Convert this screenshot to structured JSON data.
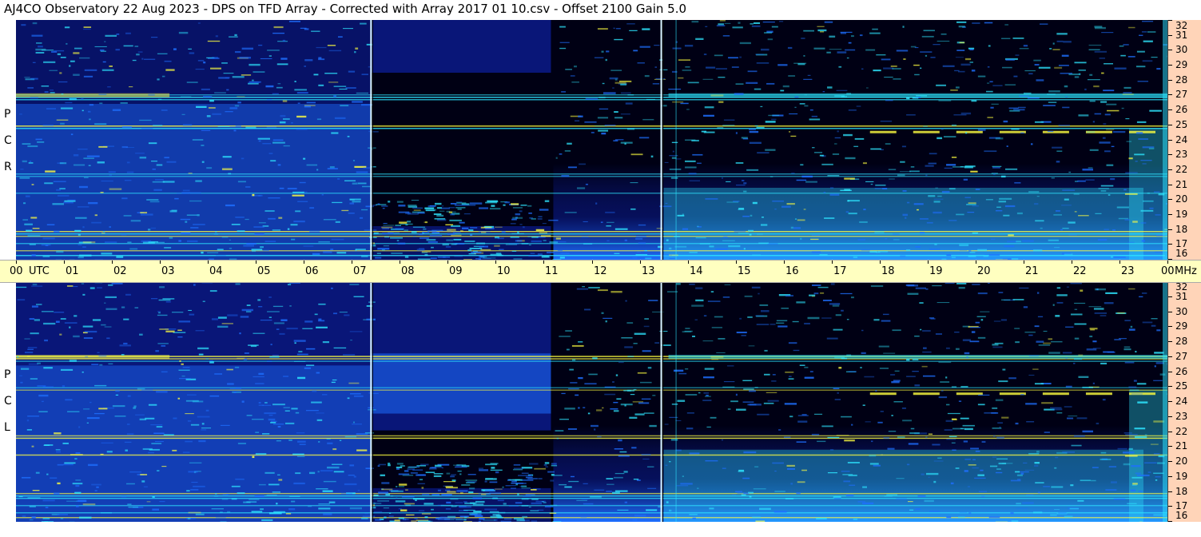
{
  "header": {
    "title": "AJ4CO Observatory  22 Aug 2023  -  DPS on TFD Array  -  Corrected with Array 2017 01 10.csv  -  Offset 2100  Gain 5.0"
  },
  "chart_data": {
    "type": "heatmap",
    "panels": [
      {
        "name": "RCP",
        "letters": [
          "P",
          "C",
          "R"
        ]
      },
      {
        "name": "LCP",
        "letters": [
          "P",
          "C",
          "L"
        ]
      }
    ],
    "time_axis": {
      "unit_label": "UTC",
      "tick_labels": [
        "00",
        "01",
        "02",
        "03",
        "04",
        "05",
        "06",
        "07",
        "08",
        "09",
        "10",
        "11",
        "12",
        "13",
        "14",
        "15",
        "16",
        "17",
        "18",
        "19",
        "20",
        "21",
        "22",
        "23",
        "00"
      ]
    },
    "freq_axis": {
      "unit_label": "MHz",
      "range": [
        16,
        32
      ],
      "tick_labels": [
        "32",
        "31",
        "30",
        "29",
        "28",
        "27",
        "26",
        "25",
        "24",
        "23",
        "22",
        "21",
        "20",
        "19",
        "18",
        "17",
        "16"
      ]
    },
    "colors": {
      "background": "#000014",
      "low": "#0a1a8a",
      "mid": "#1e6fff",
      "high": "#2ee6ff",
      "peak": "#ffff40",
      "time_axis_bg": "#ffffc0",
      "freq_strip_bg": "#ffd4b8"
    }
  }
}
